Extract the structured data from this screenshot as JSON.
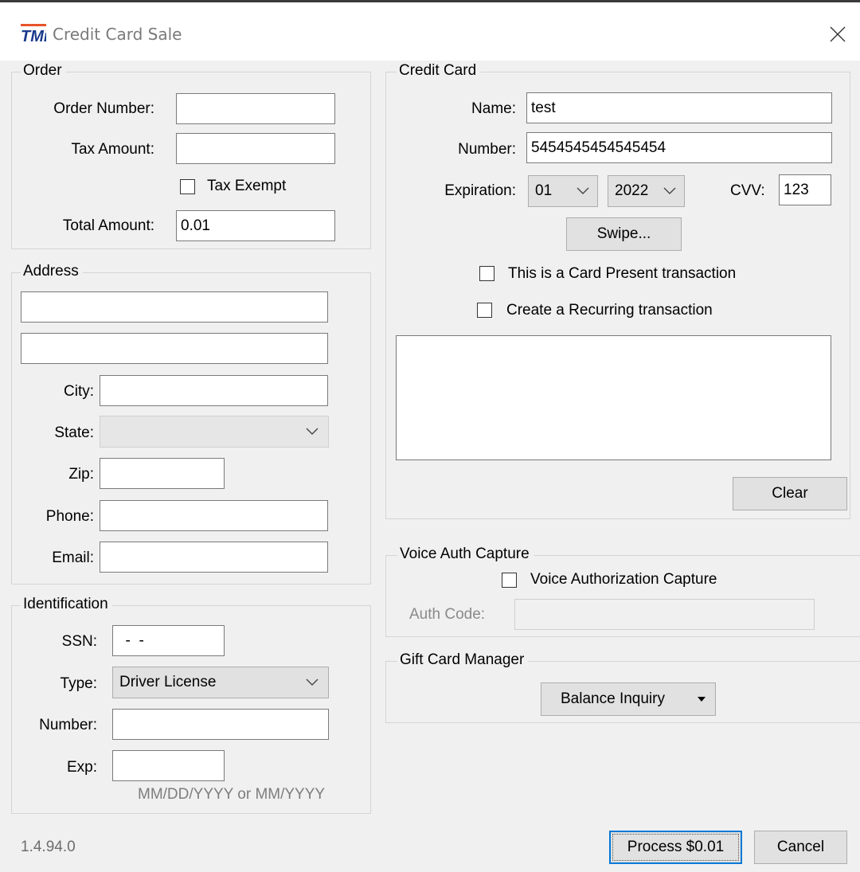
{
  "window": {
    "title": "Credit Card Sale",
    "app_icon": "tmi-logo-icon",
    "version": "1.4.94.0"
  },
  "order": {
    "title": "Order",
    "order_number_label": "Order Number:",
    "order_number_value": "",
    "tax_amount_label": "Tax Amount:",
    "tax_amount_value": "",
    "tax_exempt_label": "Tax Exempt",
    "total_amount_label": "Total Amount:",
    "total_amount_value": "0.01"
  },
  "address": {
    "title": "Address",
    "line1_value": "",
    "line2_value": "",
    "city_label": "City:",
    "city_value": "",
    "state_label": "State:",
    "state_value": "",
    "zip_label": "Zip:",
    "zip_value": "",
    "phone_label": "Phone:",
    "phone_value": "",
    "email_label": "Email:",
    "email_value": ""
  },
  "identification": {
    "title": "Identification",
    "ssn_label": "SSN:",
    "ssn_value": "  -  -",
    "type_label": "Type:",
    "type_value": "Driver License",
    "number_label": "Number:",
    "number_value": "",
    "exp_label": "Exp:",
    "exp_value": "",
    "exp_hint": "MM/DD/YYYY or MM/YYYY"
  },
  "credit_card": {
    "title": "Credit Card",
    "name_label": "Name:",
    "name_value": "test",
    "number_label": "Number:",
    "number_value": "5454545454545454",
    "expiration_label": "Expiration:",
    "exp_month": "01",
    "exp_year": "2022",
    "cvv_label": "CVV:",
    "cvv_value": "123",
    "swipe_label": "Swipe...",
    "card_present_label": "This is a Card Present transaction",
    "recurring_label": "Create a Recurring transaction",
    "clear_label": "Clear"
  },
  "voice_auth": {
    "title": "Voice Auth Capture",
    "checkbox_label": "Voice Authorization Capture",
    "auth_code_label": "Auth Code:",
    "auth_code_value": ""
  },
  "gift_card": {
    "title": "Gift Card Manager",
    "button_label": "Balance Inquiry"
  },
  "footer": {
    "process_label": "Process $0.01",
    "cancel_label": "Cancel"
  },
  "colors": {
    "accent": "#0078d7",
    "window_bg": "#f0f0f0",
    "button_bg": "#e1e1e1"
  }
}
